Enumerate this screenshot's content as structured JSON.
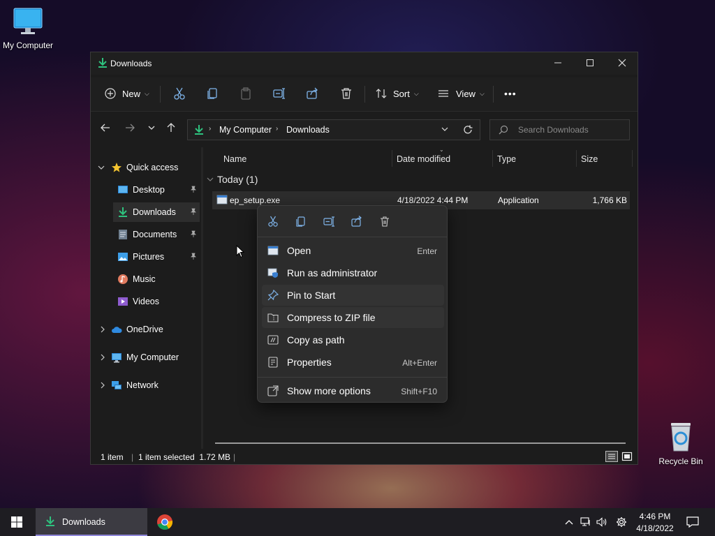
{
  "desktop": {
    "my_computer_label": "My Computer",
    "recycle_bin_label": "Recycle Bin"
  },
  "window": {
    "title": "Downloads",
    "controls": {
      "minimize": "minimize",
      "maximize": "maximize",
      "close": "close"
    }
  },
  "toolbar": {
    "new_label": "New",
    "sort_label": "Sort",
    "view_label": "View",
    "more_label": "•••"
  },
  "address": {
    "crumbs": [
      "My Computer",
      "Downloads"
    ],
    "search_placeholder": "Search Downloads"
  },
  "sidebar": {
    "quick_access": "Quick access",
    "items": [
      {
        "label": "Desktop",
        "pinned": true
      },
      {
        "label": "Downloads",
        "pinned": true,
        "selected": true
      },
      {
        "label": "Documents",
        "pinned": true
      },
      {
        "label": "Pictures",
        "pinned": true
      },
      {
        "label": "Music",
        "pinned": false
      },
      {
        "label": "Videos",
        "pinned": false
      }
    ],
    "onedrive": "OneDrive",
    "my_computer": "My Computer",
    "network": "Network"
  },
  "columns": {
    "name": "Name",
    "date": "Date modified",
    "type": "Type",
    "size": "Size"
  },
  "group": {
    "label": "Today (1)"
  },
  "files": [
    {
      "name": "ep_setup.exe",
      "date": "4/18/2022 4:44 PM",
      "type": "Application",
      "size": "1,766 KB"
    }
  ],
  "status": {
    "count": "1 item",
    "selected": "1 item selected  1.72 MB",
    "divider": "|"
  },
  "context_menu": {
    "quick_actions": [
      "cut",
      "copy",
      "rename",
      "share",
      "delete"
    ],
    "items": [
      {
        "label": "Open",
        "shortcut": "Enter"
      },
      {
        "label": "Run as administrator",
        "shortcut": ""
      },
      {
        "label": "Pin to Start",
        "shortcut": ""
      },
      {
        "label": "Compress to ZIP file",
        "shortcut": ""
      },
      {
        "label": "Copy as path",
        "shortcut": ""
      },
      {
        "label": "Properties",
        "shortcut": "Alt+Enter"
      },
      {
        "label": "Show more options",
        "shortcut": "Shift+F10"
      }
    ]
  },
  "taskbar": {
    "active_app": "Downloads",
    "time": "4:46 PM",
    "date": "4/18/2022"
  },
  "colors": {
    "accent_green": "#2ec27e",
    "folder_blue": "#4aa3df",
    "taskbar_highlight": "#8f86d9"
  }
}
